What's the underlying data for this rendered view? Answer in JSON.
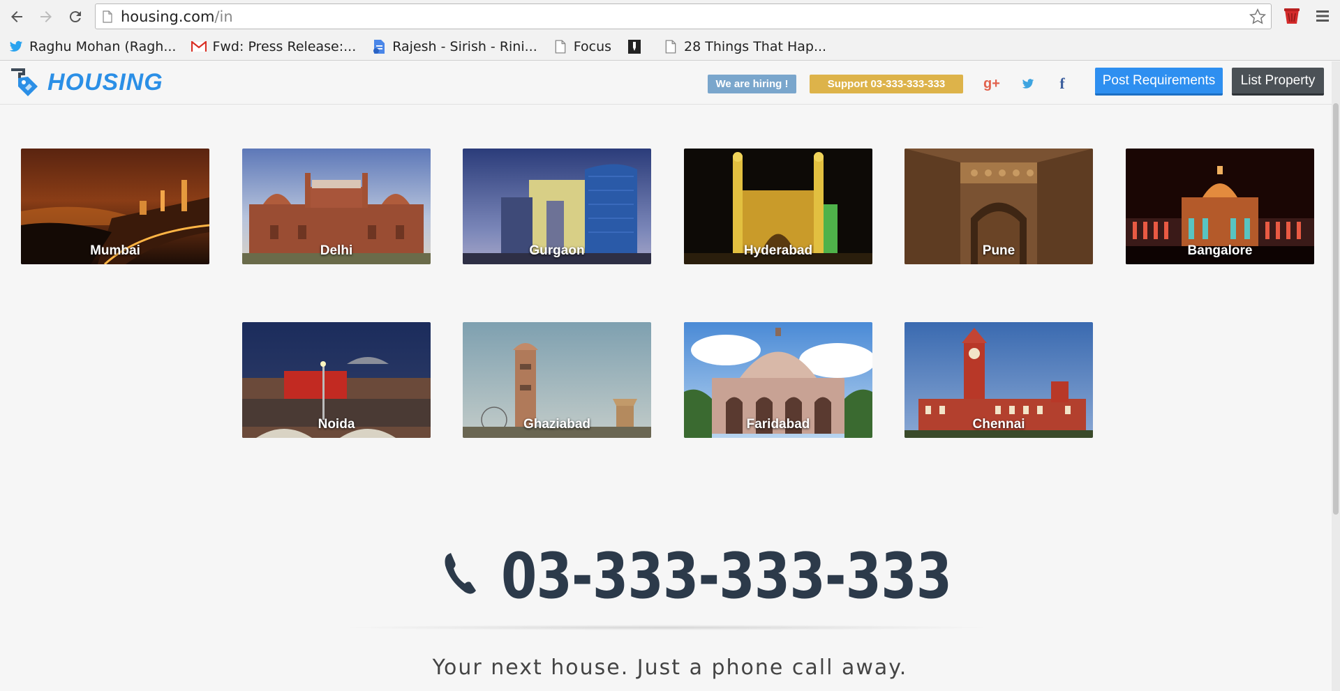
{
  "browser": {
    "url_host": "housing.com",
    "url_path": "/in",
    "bookmarks": [
      {
        "label": "Raghu Mohan (Ragh...",
        "icon": "twitter-icon"
      },
      {
        "label": "Fwd: Press Release:...",
        "icon": "gmail-icon"
      },
      {
        "label": "Rajesh - Sirish - Rini...",
        "icon": "doc-icon"
      },
      {
        "label": "Focus",
        "icon": "page-icon"
      },
      {
        "label": "",
        "icon": "bookmark-dark-icon"
      },
      {
        "label": "28 Things That Hap...",
        "icon": "page-icon"
      }
    ]
  },
  "header": {
    "logo_text": "HOUSING",
    "hiring_label": "We are hiring !",
    "support_label": "Support  03-333-333-333",
    "gplus_label": "g+",
    "fb_label": "f",
    "post_label": "Post Requirements",
    "list_label": "List Property",
    "colors": {
      "brand": "#2b8fe6",
      "hiring": "#7aa6cc",
      "support": "#ddb34a",
      "post": "#2e8ff0",
      "list": "#4b5156"
    }
  },
  "cities": [
    {
      "name": "Mumbai"
    },
    {
      "name": "Delhi"
    },
    {
      "name": "Gurgaon"
    },
    {
      "name": "Hyderabad"
    },
    {
      "name": "Pune"
    },
    {
      "name": "Bangalore"
    },
    {
      "name": "Noida"
    },
    {
      "name": "Ghaziabad"
    },
    {
      "name": "Faridabad"
    },
    {
      "name": "Chennai"
    }
  ],
  "contact": {
    "phone": "03-333-333-333",
    "tagline": "Your next house. Just a phone call away."
  }
}
